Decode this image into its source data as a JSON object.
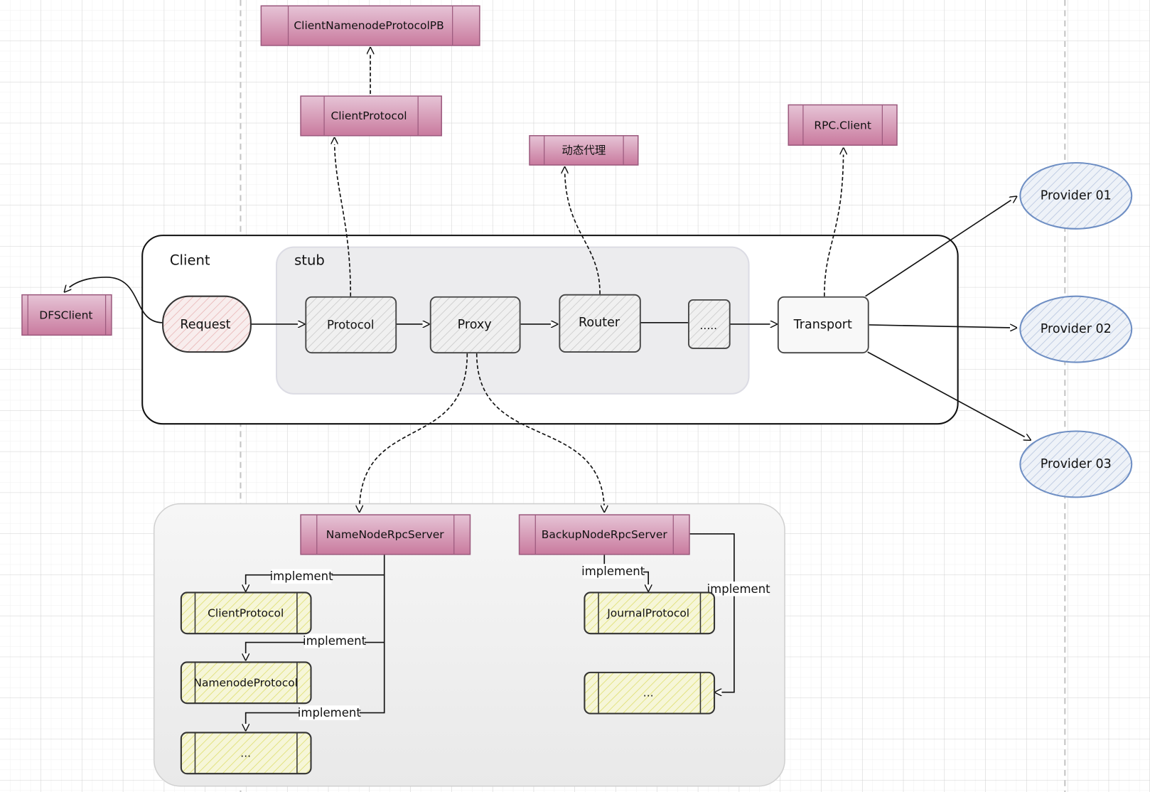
{
  "nodes": {
    "client_namenode_protocol_pb": "ClientNamenodeProtocolPB",
    "client_protocol_top": "ClientProtocol",
    "dynamic_proxy": "动态代理",
    "rpc_client": "RPC.Client",
    "dfs_client": "DFSClient",
    "client_container": "Client",
    "stub_container": "stub",
    "request": "Request",
    "protocol": "Protocol",
    "proxy": "Proxy",
    "router": "Router",
    "ellipsis_stub": ".....",
    "transport": "Transport",
    "provider_01": "Provider 01",
    "provider_02": "Provider 02",
    "provider_03": "Provider 03",
    "namenode_rpc_server": "NameNodeRpcServer",
    "backupnode_rpc_server": "BackupNodeRpcServer",
    "client_protocol_impl": "ClientProtocol",
    "namenode_protocol_impl": "NamenodeProtocol",
    "ellipsis_namenode": "...",
    "journal_protocol_impl": "JournalProtocol",
    "ellipsis_backup": "..."
  },
  "edge_labels": {
    "implement_1": "implement",
    "implement_2": "implement",
    "implement_3": "implement",
    "implement_4": "implement",
    "implement_5": "implement"
  },
  "colors": {
    "pink_top": "#e6c4d6",
    "pink_bottom": "#c97a9e",
    "pink_stroke": "#9c5a7e",
    "yellow_fill": "#f6f6d8",
    "yellow_hatch": "#dede6a",
    "gray_hatch": "#c8c8c8",
    "request_hatch": "#e8b4b4",
    "provider_stroke": "#6f8fc4",
    "provider_hatch": "#b5c4de"
  }
}
